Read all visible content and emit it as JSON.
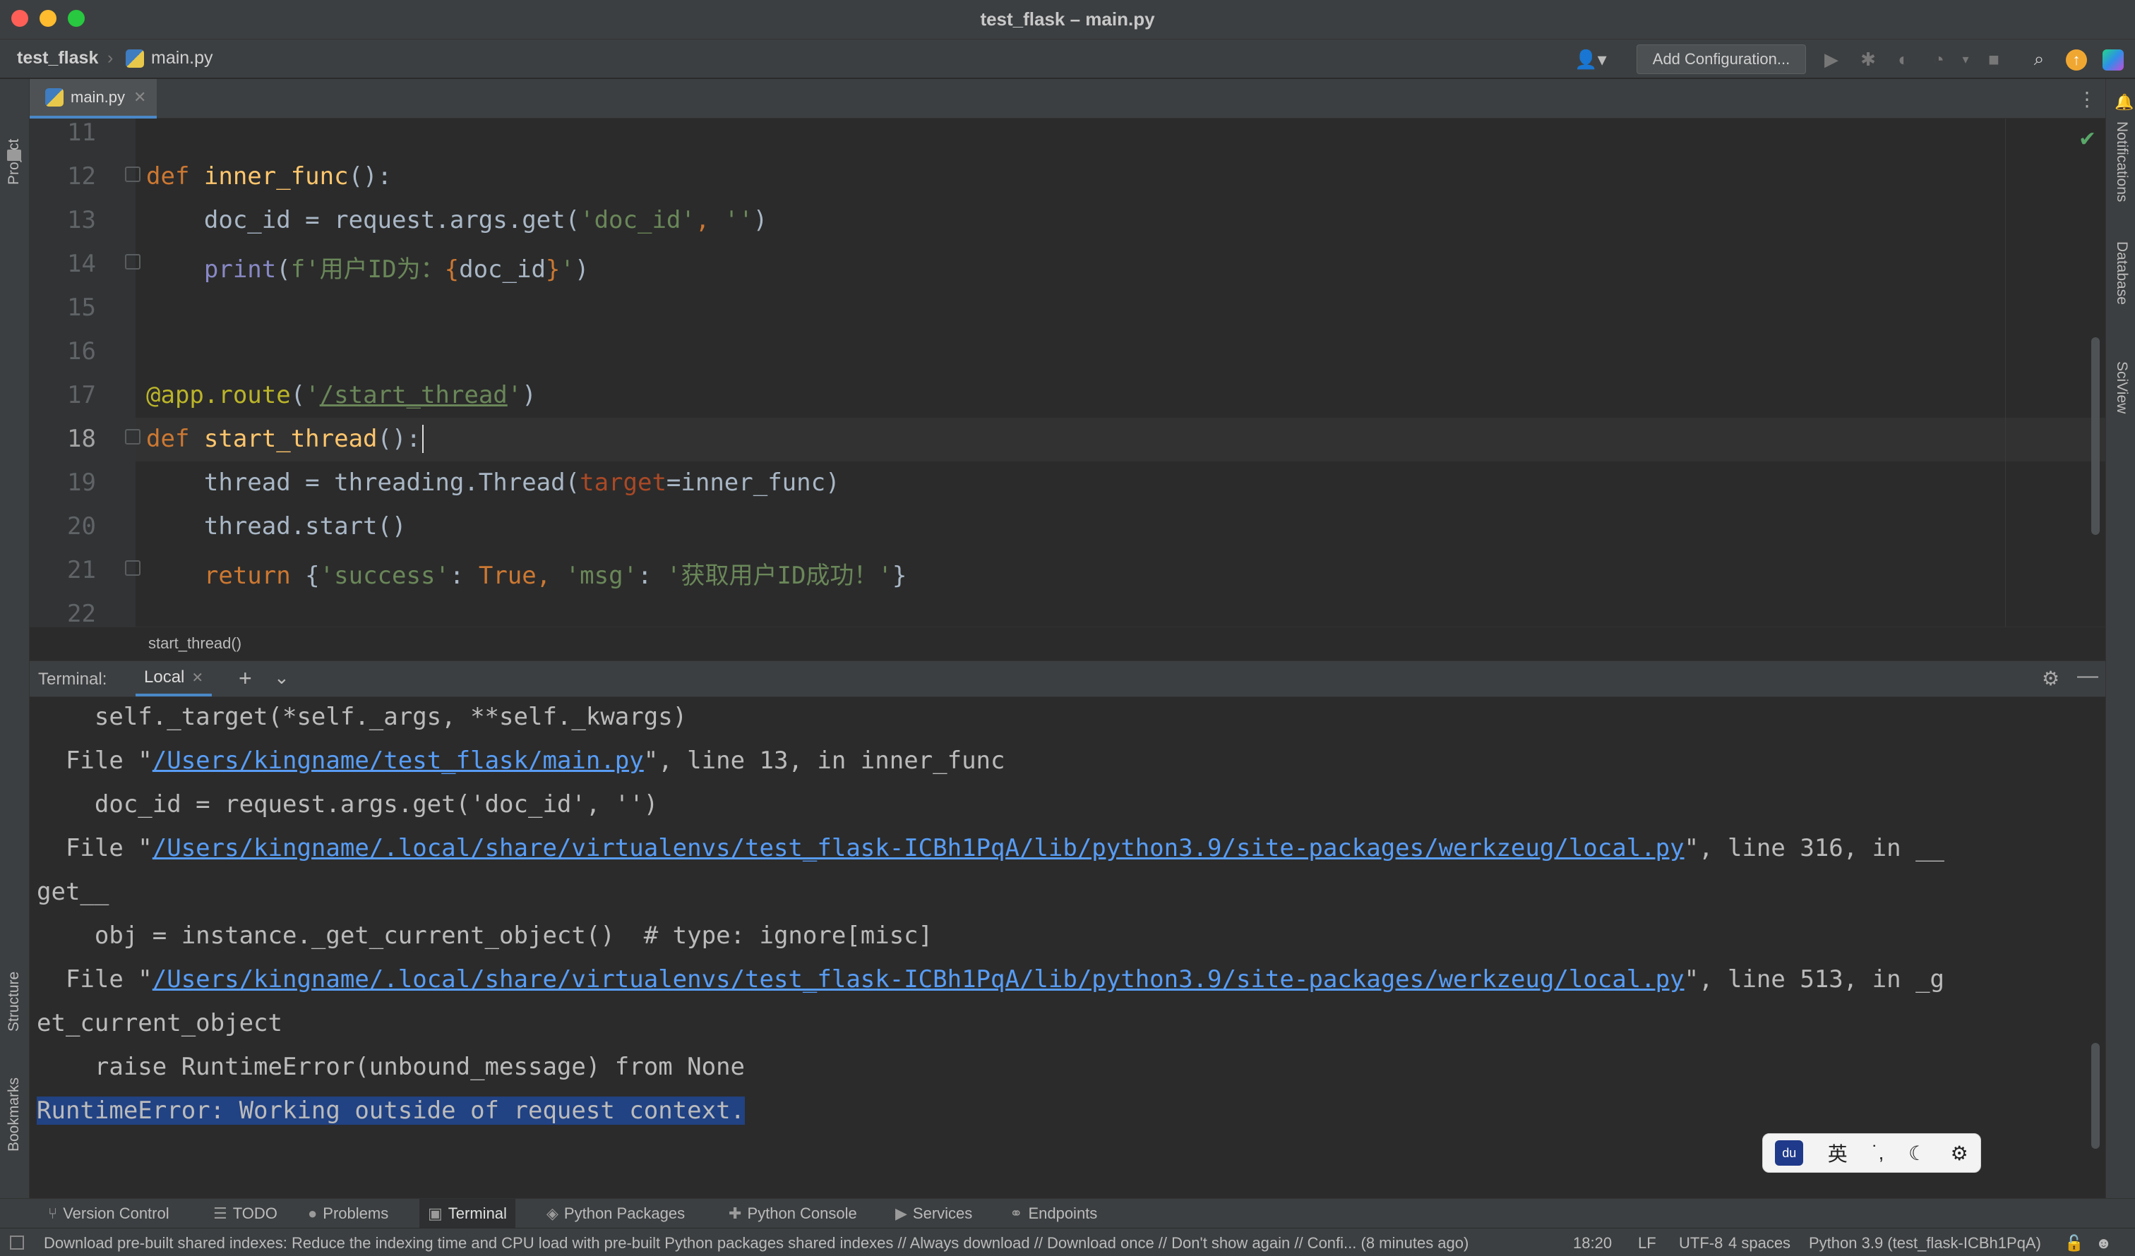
{
  "window": {
    "title": "test_flask – main.py",
    "traffic_colors": {
      "close": "#ff5f57",
      "minimize": "#febc2e",
      "zoom": "#28c840"
    }
  },
  "navbar": {
    "project": "test_flask",
    "file": "main.py",
    "add_config_label": "Add Configuration..."
  },
  "left_strip": {
    "project": "Project",
    "structure": "Structure",
    "bookmarks": "Bookmarks"
  },
  "right_strip": {
    "notifications": "Notifications",
    "database": "Database",
    "sciview": "SciView"
  },
  "tabs": [
    {
      "label": "main.py",
      "active": true
    }
  ],
  "editor": {
    "line_numbers": [
      "11",
      "12",
      "13",
      "14",
      "15",
      "16",
      "17",
      "18",
      "19",
      "20",
      "21",
      "22"
    ],
    "current_line": "18",
    "code": {
      "l12_kw": "def ",
      "l12_fn": "inner_func",
      "l12_rest": "():",
      "l13_a": "    doc_id = request.args.get(",
      "l13_s1": "'doc_id'",
      "l13_c": ", ",
      "l13_s2": "''",
      "l13_e": ")",
      "l14_bi": "    print",
      "l14_p": "(",
      "l14_s": "f'用户ID为：",
      "l14_b1": "{",
      "l14_v": "doc_id",
      "l14_b2": "}",
      "l14_s2": "'",
      "l14_e": ")",
      "l17_deco": "@app.route",
      "l17_p": "(",
      "l17_s1": "'",
      "l17_path": "/start_thread",
      "l17_s2": "'",
      "l17_e": ")",
      "l18_kw": "def ",
      "l18_fn": "start_thread",
      "l18_rest": "():",
      "l19_a": "    thread = threading.Thread(",
      "l19_param": "target",
      "l19_b": "=inner_func)",
      "l20": "    thread.start()",
      "l21_kw": "    return ",
      "l21_a": "{",
      "l21_s1": "'success'",
      "l21_b": ": ",
      "l21_kw2": "True",
      "l21_c": ", ",
      "l21_s2": "'msg'",
      "l21_d": ": ",
      "l21_s3": "'获取用户ID成功！'",
      "l21_e": "}"
    },
    "breadcrumb": "start_thread()"
  },
  "terminal": {
    "label": "Terminal:",
    "tab": "Local",
    "lines": {
      "t1": "    self._target(*self._args, **self._kwargs)",
      "t2a": "  File \"",
      "t2link": "/Users/kingname/test_flask/main.py",
      "t2b": "\", line 13, in inner_func",
      "t3": "    doc_id = request.args.get('doc_id', '')",
      "t4a": "  File \"",
      "t4link": "/Users/kingname/.local/share/virtualenvs/test_flask-ICBh1PqA/lib/python3.9/site-packages/werkzeug/local.py",
      "t4b": "\", line 316, in __",
      "t5": "get__",
      "t6": "    obj = instance._get_current_object()  # type: ignore[misc]",
      "t7a": "  File \"",
      "t7link": "/Users/kingname/.local/share/virtualenvs/test_flask-ICBh1PqA/lib/python3.9/site-packages/werkzeug/local.py",
      "t7b": "\", line 513, in _g",
      "t8": "et_current_object",
      "t9": "    raise RuntimeError(unbound_message) from None",
      "t10": "RuntimeError: Working outside of request context."
    }
  },
  "ime": {
    "lang": "英",
    "punct": "˙,"
  },
  "toolwindows": [
    {
      "label": "Version Control",
      "icon": "branch-icon"
    },
    {
      "label": "TODO",
      "icon": "list-icon"
    },
    {
      "label": "Problems",
      "icon": "info-icon"
    },
    {
      "label": "Terminal",
      "icon": "terminal-icon",
      "active": true
    },
    {
      "label": "Python Packages",
      "icon": "layers-icon"
    },
    {
      "label": "Python Console",
      "icon": "python-icon"
    },
    {
      "label": "Services",
      "icon": "play-circle-icon"
    },
    {
      "label": "Endpoints",
      "icon": "endpoints-icon"
    }
  ],
  "status": {
    "message": "Download pre-built shared indexes: Reduce the indexing time and CPU load with pre-built Python packages shared indexes // Always download // Download once // Don't show again // Confi... (8 minutes ago)",
    "position": "18:20",
    "line_sep": "LF",
    "encoding": "UTF-8",
    "indent": "4 spaces",
    "interpreter": "Python 3.9 (test_flask-ICBh1PqA)"
  }
}
